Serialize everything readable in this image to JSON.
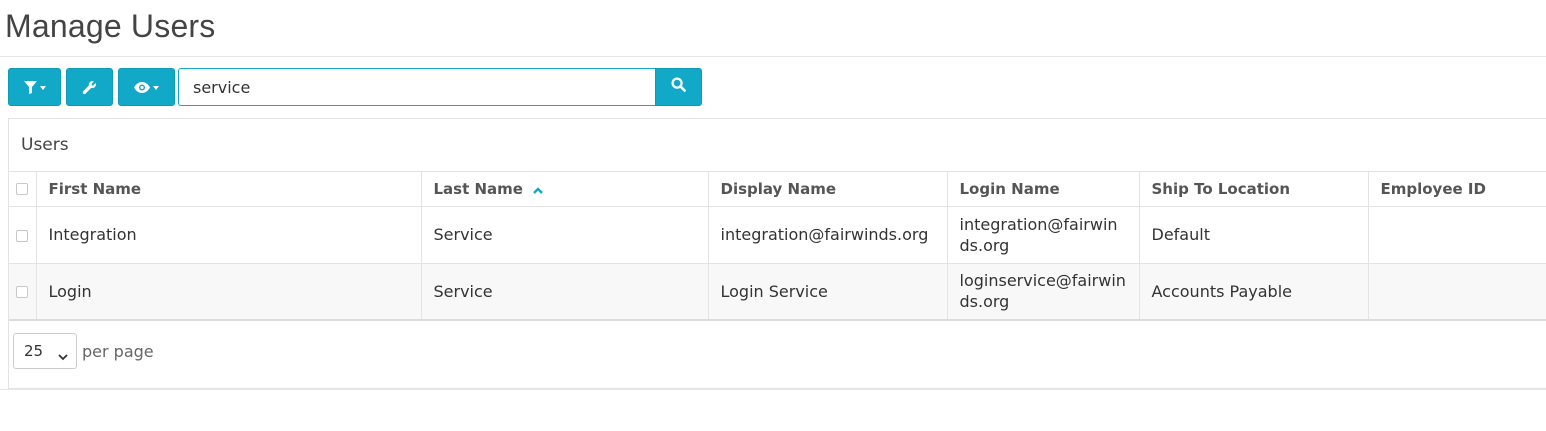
{
  "page": {
    "title": "Manage Users"
  },
  "toolbar": {
    "filter_icon": "filter-icon",
    "tools_icon": "wrench-icon",
    "view_icon": "eye-icon",
    "accent_color": "#12a9c8"
  },
  "search": {
    "value": "service",
    "button_icon": "search-icon"
  },
  "panel": {
    "title": "Users"
  },
  "table": {
    "columns": [
      "First Name",
      "Last Name",
      "Display Name",
      "Login Name",
      "Ship To Location",
      "Employee ID"
    ],
    "sorted_column": "Last Name",
    "sort_direction": "ascending",
    "rows": [
      {
        "first_name": "Integration",
        "last_name": "Service",
        "display_name": "integration@fairwinds.org",
        "login_name": "integration@fairwinds.org",
        "ship_to": "Default",
        "employee_id": ""
      },
      {
        "first_name": "Login",
        "last_name": "Service",
        "display_name": "Login Service",
        "login_name": "loginservice@fairwinds.org",
        "ship_to": "Accounts Payable",
        "employee_id": ""
      }
    ]
  },
  "pagination": {
    "per_page_value": "25",
    "per_page_label": "per page"
  }
}
